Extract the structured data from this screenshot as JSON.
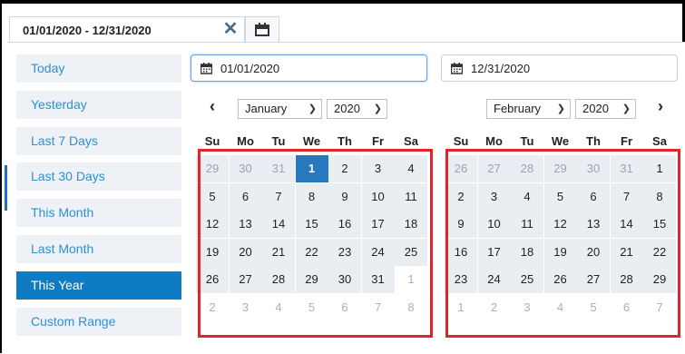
{
  "range_input": {
    "value": "01/01/2020 - 12/31/2020",
    "clear_glyph": "✕"
  },
  "ranges": [
    {
      "label": "Today",
      "active": false
    },
    {
      "label": "Yesterday",
      "active": false
    },
    {
      "label": "Last 7 Days",
      "active": false
    },
    {
      "label": "Last 30 Days",
      "active": false
    },
    {
      "label": "This Month",
      "active": false
    },
    {
      "label": "Last Month",
      "active": false
    },
    {
      "label": "This Year",
      "active": true
    },
    {
      "label": "Custom Range",
      "active": false
    }
  ],
  "start_field": {
    "value": "01/01/2020"
  },
  "end_field": {
    "value": "12/31/2020"
  },
  "nav": {
    "prev": "‹",
    "next": "›"
  },
  "weekdays": [
    "Su",
    "Mo",
    "Tu",
    "We",
    "Th",
    "Fr",
    "Sa"
  ],
  "left_calendar": {
    "month": "January",
    "year": "2020",
    "weeks": [
      [
        "29",
        "30",
        "31",
        "1",
        "2",
        "3",
        "4"
      ],
      [
        "5",
        "6",
        "7",
        "8",
        "9",
        "10",
        "11"
      ],
      [
        "12",
        "13",
        "14",
        "15",
        "16",
        "17",
        "18"
      ],
      [
        "19",
        "20",
        "21",
        "22",
        "23",
        "24",
        "25"
      ],
      [
        "26",
        "27",
        "28",
        "29",
        "30",
        "31",
        "1"
      ],
      [
        "2",
        "3",
        "4",
        "5",
        "6",
        "7",
        "8"
      ]
    ]
  },
  "right_calendar": {
    "month": "February",
    "year": "2020",
    "weeks": [
      [
        "26",
        "27",
        "28",
        "29",
        "30",
        "31",
        "1"
      ],
      [
        "2",
        "3",
        "4",
        "5",
        "6",
        "7",
        "8"
      ],
      [
        "9",
        "10",
        "11",
        "12",
        "13",
        "14",
        "15"
      ],
      [
        "16",
        "17",
        "18",
        "19",
        "20",
        "21",
        "22"
      ],
      [
        "23",
        "24",
        "25",
        "26",
        "27",
        "28",
        "29"
      ],
      [
        "1",
        "2",
        "3",
        "4",
        "5",
        "6",
        "7"
      ]
    ]
  },
  "colors": {
    "accent": "#0e7bc2",
    "selected_day": "#2878bd",
    "highlight": "#e0252c",
    "in_range": "#e9eef3"
  }
}
